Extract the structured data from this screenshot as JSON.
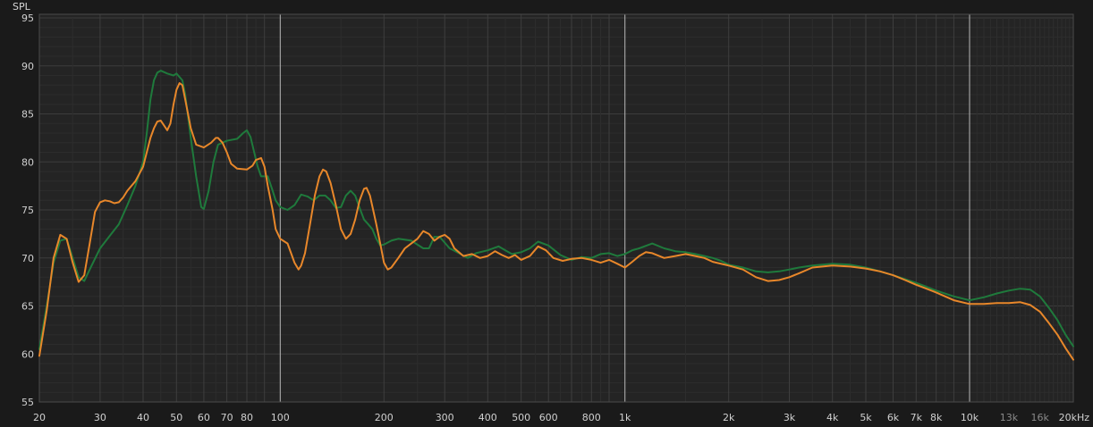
{
  "chart_data": {
    "type": "line",
    "ylabel": "SPL",
    "xscale": "log",
    "xlim": [
      20,
      20000
    ],
    "ylim": [
      55,
      95
    ],
    "grid": true,
    "y_ticks": [
      95,
      90,
      85,
      80,
      75,
      70,
      65,
      60,
      55
    ],
    "x_ticks": [
      {
        "value": 20,
        "label": "20"
      },
      {
        "value": 30,
        "label": "30"
      },
      {
        "value": 40,
        "label": "40"
      },
      {
        "value": 50,
        "label": "50"
      },
      {
        "value": 60,
        "label": "60"
      },
      {
        "value": 70,
        "label": "70"
      },
      {
        "value": 80,
        "label": "80"
      },
      {
        "value": 100,
        "label": "100"
      },
      {
        "value": 200,
        "label": "200"
      },
      {
        "value": 300,
        "label": "300"
      },
      {
        "value": 400,
        "label": "400"
      },
      {
        "value": 500,
        "label": "500"
      },
      {
        "value": 600,
        "label": "600"
      },
      {
        "value": 800,
        "label": "800"
      },
      {
        "value": 1000,
        "label": "1k"
      },
      {
        "value": 2000,
        "label": "2k"
      },
      {
        "value": 3000,
        "label": "3k"
      },
      {
        "value": 4000,
        "label": "4k"
      },
      {
        "value": 5000,
        "label": "5k"
      },
      {
        "value": 6000,
        "label": "6k"
      },
      {
        "value": 7000,
        "label": "7k"
      },
      {
        "value": 8000,
        "label": "8k"
      },
      {
        "value": 10000,
        "label": "10k"
      },
      {
        "value": 13000,
        "label": "13k",
        "dim": true
      },
      {
        "value": 16000,
        "label": "16k",
        "dim": true
      },
      {
        "value": 20000,
        "label": "20kHz"
      }
    ],
    "series": [
      {
        "color": "#1f7a3c",
        "points": [
          [
            20,
            60.5
          ],
          [
            21,
            65
          ],
          [
            22,
            69.5
          ],
          [
            23,
            71.8
          ],
          [
            24,
            72
          ],
          [
            25,
            70
          ],
          [
            26,
            68
          ],
          [
            27,
            67.6
          ],
          [
            28,
            68.8
          ],
          [
            30,
            71
          ],
          [
            32,
            72.3
          ],
          [
            34,
            73.5
          ],
          [
            36,
            75.5
          ],
          [
            38,
            77.5
          ],
          [
            40,
            80
          ],
          [
            41,
            83
          ],
          [
            42,
            86.5
          ],
          [
            43,
            88.5
          ],
          [
            44,
            89.3
          ],
          [
            45,
            89.5
          ],
          [
            47,
            89.2
          ],
          [
            49,
            89
          ],
          [
            50,
            89.2
          ],
          [
            52,
            88.5
          ],
          [
            53,
            87
          ],
          [
            55,
            82.5
          ],
          [
            57,
            78.5
          ],
          [
            59,
            75.3
          ],
          [
            60,
            75.1
          ],
          [
            62,
            77
          ],
          [
            64,
            80
          ],
          [
            66,
            81.8
          ],
          [
            70,
            82.2
          ],
          [
            75,
            82.4
          ],
          [
            78,
            83
          ],
          [
            80,
            83.3
          ],
          [
            82,
            82.6
          ],
          [
            84,
            81
          ],
          [
            86,
            79.5
          ],
          [
            88,
            78.5
          ],
          [
            92,
            78.5
          ],
          [
            95,
            77
          ],
          [
            97,
            76
          ],
          [
            100,
            75.3
          ],
          [
            105,
            75
          ],
          [
            110,
            75.5
          ],
          [
            115,
            76.6
          ],
          [
            120,
            76.4
          ],
          [
            125,
            76
          ],
          [
            130,
            76.5
          ],
          [
            135,
            76.5
          ],
          [
            140,
            76
          ],
          [
            145,
            75.2
          ],
          [
            150,
            75.3
          ],
          [
            155,
            76.5
          ],
          [
            160,
            77
          ],
          [
            165,
            76.5
          ],
          [
            170,
            75.2
          ],
          [
            175,
            74
          ],
          [
            180,
            73.5
          ],
          [
            185,
            73
          ],
          [
            190,
            72
          ],
          [
            195,
            71.3
          ],
          [
            200,
            71.4
          ],
          [
            210,
            71.8
          ],
          [
            220,
            72
          ],
          [
            240,
            71.8
          ],
          [
            260,
            71
          ],
          [
            270,
            71
          ],
          [
            280,
            72.2
          ],
          [
            290,
            72.2
          ],
          [
            300,
            71.6
          ],
          [
            310,
            71
          ],
          [
            330,
            70.5
          ],
          [
            350,
            70
          ],
          [
            370,
            70.5
          ],
          [
            400,
            70.8
          ],
          [
            430,
            71.2
          ],
          [
            450,
            70.8
          ],
          [
            470,
            70.4
          ],
          [
            500,
            70.6
          ],
          [
            530,
            71
          ],
          [
            560,
            71.7
          ],
          [
            600,
            71.3
          ],
          [
            650,
            70.3
          ],
          [
            700,
            69.8
          ],
          [
            750,
            70.1
          ],
          [
            800,
            70
          ],
          [
            850,
            70.4
          ],
          [
            900,
            70.5
          ],
          [
            950,
            70.2
          ],
          [
            1000,
            70.4
          ],
          [
            1050,
            70.8
          ],
          [
            1100,
            71
          ],
          [
            1200,
            71.5
          ],
          [
            1300,
            71
          ],
          [
            1400,
            70.7
          ],
          [
            1500,
            70.6
          ],
          [
            1600,
            70.4
          ],
          [
            1700,
            70.2
          ],
          [
            1800,
            70
          ],
          [
            1900,
            69.7
          ],
          [
            2000,
            69.3
          ],
          [
            2200,
            69
          ],
          [
            2400,
            68.6
          ],
          [
            2600,
            68.5
          ],
          [
            2800,
            68.6
          ],
          [
            3000,
            68.8
          ],
          [
            3200,
            69
          ],
          [
            3500,
            69.2
          ],
          [
            4000,
            69.4
          ],
          [
            4500,
            69.3
          ],
          [
            5000,
            69
          ],
          [
            5500,
            68.6
          ],
          [
            6000,
            68.2
          ],
          [
            6500,
            67.8
          ],
          [
            7000,
            67.4
          ],
          [
            7500,
            67
          ],
          [
            8000,
            66.6
          ],
          [
            9000,
            66
          ],
          [
            10000,
            65.6
          ],
          [
            11000,
            65.9
          ],
          [
            12000,
            66.3
          ],
          [
            13000,
            66.6
          ],
          [
            14000,
            66.8
          ],
          [
            15000,
            66.7
          ],
          [
            16000,
            66
          ],
          [
            17000,
            64.8
          ],
          [
            18000,
            63.5
          ],
          [
            19000,
            62
          ],
          [
            20000,
            60.8
          ]
        ]
      },
      {
        "color": "#e8872a",
        "points": [
          [
            20,
            59.8
          ],
          [
            21,
            64.5
          ],
          [
            22,
            70
          ],
          [
            23,
            72.4
          ],
          [
            24,
            72
          ],
          [
            25,
            69.5
          ],
          [
            26,
            67.5
          ],
          [
            27,
            68.2
          ],
          [
            28,
            71.5
          ],
          [
            29,
            74.8
          ],
          [
            30,
            75.8
          ],
          [
            31,
            76
          ],
          [
            32,
            75.9
          ],
          [
            33,
            75.7
          ],
          [
            34,
            75.8
          ],
          [
            35,
            76.3
          ],
          [
            36,
            77
          ],
          [
            38,
            78
          ],
          [
            40,
            79.5
          ],
          [
            41,
            81
          ],
          [
            42,
            82.5
          ],
          [
            43,
            83.5
          ],
          [
            44,
            84.2
          ],
          [
            45,
            84.3
          ],
          [
            46,
            83.8
          ],
          [
            47,
            83.3
          ],
          [
            48,
            84
          ],
          [
            49,
            86
          ],
          [
            50,
            87.5
          ],
          [
            51,
            88.2
          ],
          [
            52,
            88
          ],
          [
            53,
            86.5
          ],
          [
            55,
            83.5
          ],
          [
            57,
            81.8
          ],
          [
            60,
            81.5
          ],
          [
            63,
            82
          ],
          [
            65,
            82.5
          ],
          [
            66,
            82.5
          ],
          [
            68,
            82
          ],
          [
            70,
            81
          ],
          [
            72,
            79.8
          ],
          [
            75,
            79.3
          ],
          [
            80,
            79.2
          ],
          [
            83,
            79.6
          ],
          [
            85,
            80.2
          ],
          [
            88,
            80.4
          ],
          [
            90,
            79.5
          ],
          [
            92,
            77.5
          ],
          [
            95,
            75
          ],
          [
            97,
            73
          ],
          [
            100,
            72
          ],
          [
            105,
            71.5
          ],
          [
            110,
            69.5
          ],
          [
            113,
            68.8
          ],
          [
            115,
            69.2
          ],
          [
            118,
            70.5
          ],
          [
            122,
            73.5
          ],
          [
            126,
            76.5
          ],
          [
            130,
            78.5
          ],
          [
            133,
            79.2
          ],
          [
            136,
            79
          ],
          [
            140,
            77.8
          ],
          [
            145,
            75.5
          ],
          [
            150,
            73
          ],
          [
            155,
            72
          ],
          [
            160,
            72.5
          ],
          [
            165,
            74
          ],
          [
            170,
            76
          ],
          [
            175,
            77.2
          ],
          [
            178,
            77.3
          ],
          [
            182,
            76.5
          ],
          [
            186,
            75
          ],
          [
            190,
            73.5
          ],
          [
            195,
            71.5
          ],
          [
            200,
            69.5
          ],
          [
            205,
            68.8
          ],
          [
            210,
            69
          ],
          [
            220,
            70
          ],
          [
            230,
            71
          ],
          [
            240,
            71.5
          ],
          [
            250,
            72
          ],
          [
            260,
            72.8
          ],
          [
            270,
            72.5
          ],
          [
            280,
            71.8
          ],
          [
            290,
            72.2
          ],
          [
            300,
            72.4
          ],
          [
            310,
            72
          ],
          [
            320,
            71
          ],
          [
            340,
            70.2
          ],
          [
            360,
            70.4
          ],
          [
            380,
            70
          ],
          [
            400,
            70.2
          ],
          [
            420,
            70.7
          ],
          [
            440,
            70.3
          ],
          [
            460,
            70
          ],
          [
            480,
            70.3
          ],
          [
            500,
            69.8
          ],
          [
            530,
            70.2
          ],
          [
            560,
            71.2
          ],
          [
            590,
            70.8
          ],
          [
            620,
            70
          ],
          [
            660,
            69.7
          ],
          [
            700,
            69.9
          ],
          [
            750,
            70
          ],
          [
            800,
            69.8
          ],
          [
            850,
            69.5
          ],
          [
            900,
            69.8
          ],
          [
            950,
            69.4
          ],
          [
            1000,
            69
          ],
          [
            1050,
            69.6
          ],
          [
            1100,
            70.2
          ],
          [
            1150,
            70.6
          ],
          [
            1200,
            70.5
          ],
          [
            1300,
            70
          ],
          [
            1400,
            70.2
          ],
          [
            1500,
            70.4
          ],
          [
            1600,
            70.2
          ],
          [
            1700,
            70
          ],
          [
            1800,
            69.6
          ],
          [
            2000,
            69.2
          ],
          [
            2200,
            68.8
          ],
          [
            2400,
            68
          ],
          [
            2600,
            67.6
          ],
          [
            2800,
            67.7
          ],
          [
            3000,
            68
          ],
          [
            3200,
            68.4
          ],
          [
            3500,
            69
          ],
          [
            4000,
            69.2
          ],
          [
            4500,
            69.1
          ],
          [
            5000,
            68.9
          ],
          [
            5500,
            68.6
          ],
          [
            6000,
            68.2
          ],
          [
            6500,
            67.7
          ],
          [
            7000,
            67.2
          ],
          [
            7500,
            66.8
          ],
          [
            8000,
            66.4
          ],
          [
            9000,
            65.6
          ],
          [
            10000,
            65.2
          ],
          [
            11000,
            65.2
          ],
          [
            12000,
            65.3
          ],
          [
            13000,
            65.3
          ],
          [
            14000,
            65.4
          ],
          [
            15000,
            65.1
          ],
          [
            16000,
            64.4
          ],
          [
            17000,
            63.2
          ],
          [
            18000,
            62
          ],
          [
            19000,
            60.6
          ],
          [
            20000,
            59.4
          ]
        ]
      }
    ]
  }
}
